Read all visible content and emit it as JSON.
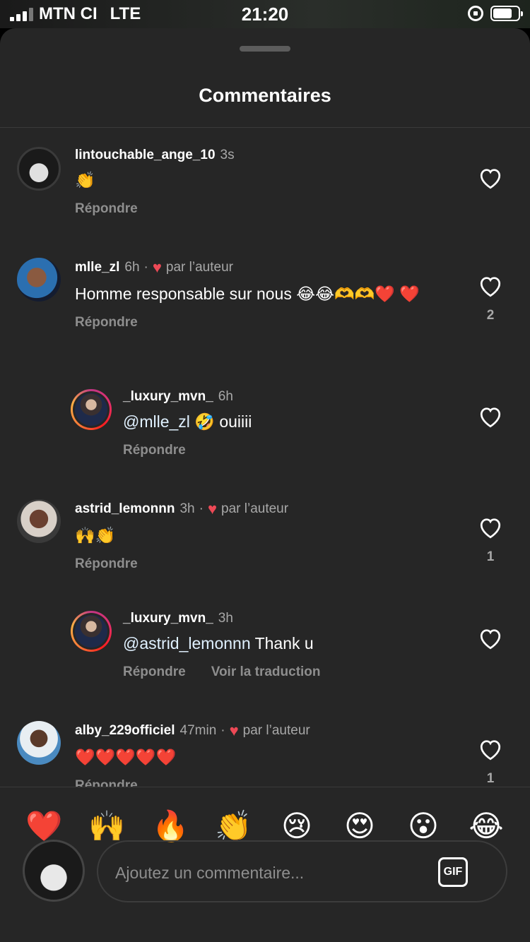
{
  "status_bar": {
    "carrier": "MTN CI",
    "network": "LTE",
    "time": "21:20"
  },
  "sheet": {
    "title": "Commentaires"
  },
  "comments": [
    {
      "username": "lintouchable_ange_10",
      "time": "3s",
      "liked_by_author": false,
      "text": "👏",
      "reply_label": "Répondre",
      "like_count": "",
      "is_reply": false
    },
    {
      "username": "mlle_zl",
      "time": "6h",
      "liked_by_author": true,
      "author_label": "par l’auteur",
      "text": "Homme responsable sur nous 😂😂🫶🫶❤️ ❤️",
      "reply_label": "Répondre",
      "like_count": "2",
      "is_reply": false
    },
    {
      "username": "_luxury_mvn_",
      "time": "6h",
      "liked_by_author": false,
      "mention": "@mlle_zl",
      "text": "🤣 ouiiii",
      "reply_label": "Répondre",
      "like_count": "",
      "is_reply": true
    },
    {
      "username": "astrid_lemonnn",
      "time": "3h",
      "liked_by_author": true,
      "author_label": "par l’auteur",
      "text": "🙌👏",
      "reply_label": "Répondre",
      "like_count": "1",
      "is_reply": false
    },
    {
      "username": "_luxury_mvn_",
      "time": "3h",
      "liked_by_author": false,
      "mention": "@astrid_lemonnn",
      "text": "Thank u",
      "reply_label": "Répondre",
      "translate_label": "Voir la traduction",
      "like_count": "",
      "is_reply": true
    },
    {
      "username": "alby_229officiel",
      "time": "47min",
      "liked_by_author": true,
      "author_label": "par l’auteur",
      "text": "❤️❤️❤️❤️❤️",
      "reply_label": "Répondre",
      "like_count": "1",
      "is_reply": false
    }
  ],
  "reactions": [
    "❤️",
    "🙌",
    "🔥",
    "👏",
    "😢",
    "😍",
    "😮",
    "😂"
  ],
  "composer": {
    "placeholder": "Ajoutez un commentaire...",
    "gif_label": "GIF"
  },
  "icons": {
    "like": "heart-outline-icon",
    "author_like": "heart-filled-icon",
    "gif": "gif-icon"
  },
  "colors": {
    "sheet_bg": "#262626",
    "author_heart": "#ed4956",
    "secondary_text": "#a8a8a8"
  }
}
